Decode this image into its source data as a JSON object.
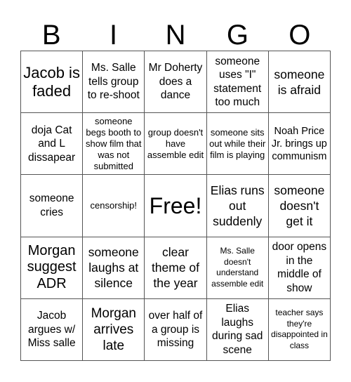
{
  "header": {
    "letters": [
      "B",
      "I",
      "N",
      "G",
      "O"
    ]
  },
  "cells": [
    "Jacob is faded",
    "Ms. Salle tells group to re-shoot",
    "Mr Doherty does a dance",
    "someone uses \"I\" statement too much",
    "someone is afraid",
    "doja Cat and L dissapear",
    "someone begs booth to show film that was not submitted",
    "group doesn't have assemble edit",
    "someone sits out while their film is playing",
    "Noah Price Jr. brings up communism",
    "someone cries",
    "censorship!",
    "Free!",
    "Elias runs out suddenly",
    "someone doesn't get it",
    "Morgan suggest ADR",
    "someone laughs at silence",
    "clear theme of the year",
    "Ms. Salle doesn't understand assemble edit",
    "door opens in the middle of show",
    "Jacob argues w/ Miss salle",
    "Morgan arrives late",
    "over half of a group is missing",
    "Elias laughs during sad scene",
    "teacher says they're disappointed in class"
  ]
}
